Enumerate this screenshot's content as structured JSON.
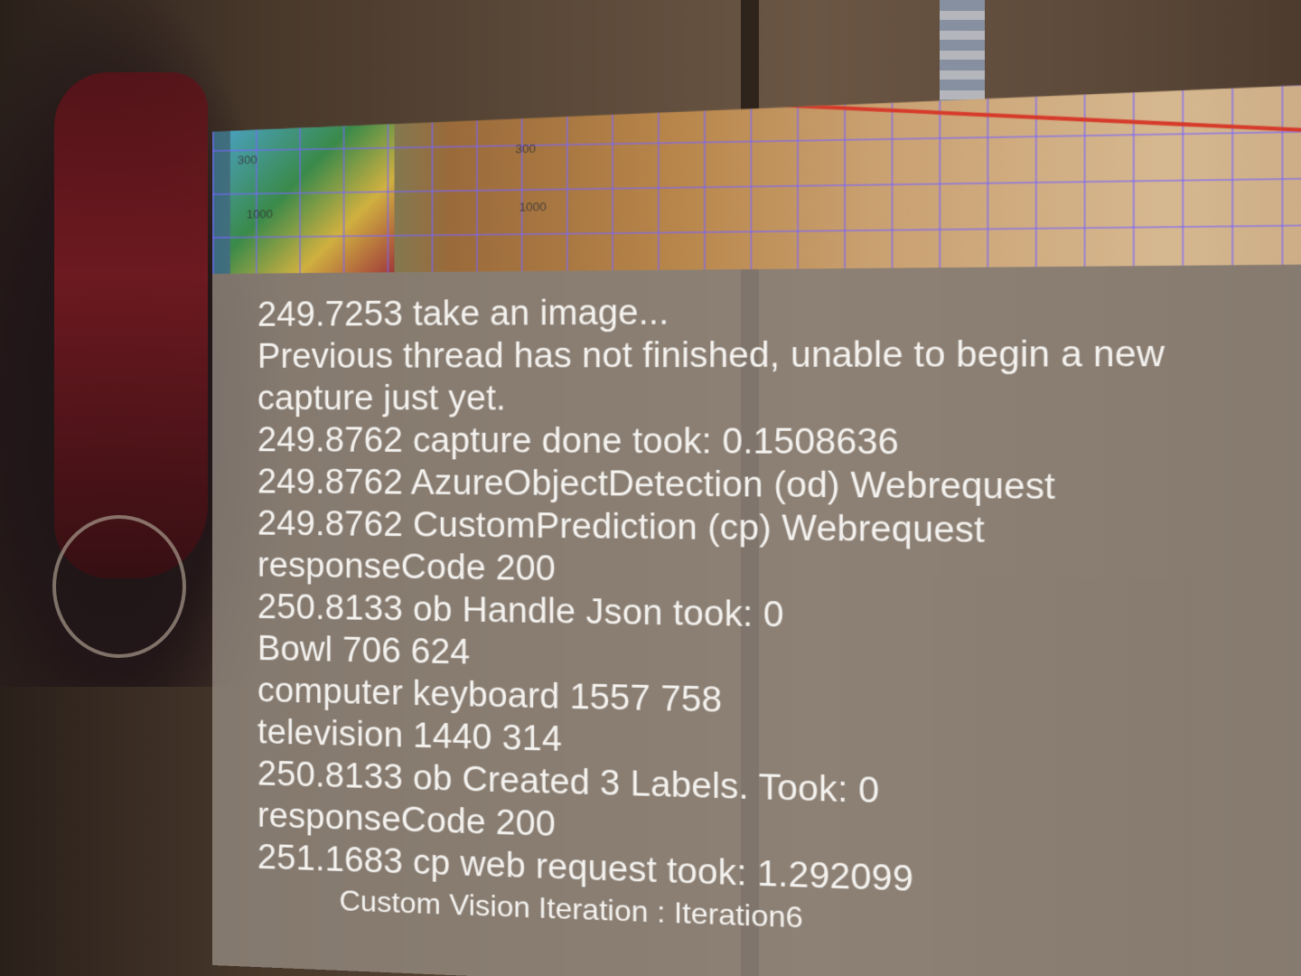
{
  "preview": {
    "scale_labels": [
      "300",
      "300",
      "1000",
      "1000"
    ]
  },
  "log": {
    "lines": [
      "249.7253 take an image...",
      "Previous thread has not finished, unable to begin a new",
      "capture just yet.",
      "249.8762 capture done took: 0.1508636",
      "249.8762 AzureObjectDetection (od) Webrequest",
      "249.8762 CustomPrediction (cp) Webrequest",
      "responseCode 200",
      "250.8133 ob Handle Json took: 0",
      "Bowl 706 624",
      "computer keyboard 1557 758",
      "television 1440 314",
      "250.8133 ob Created 3 Labels. Took: 0",
      "responseCode 200",
      "251.1683 cp web request took: 1.292099"
    ]
  },
  "footer": {
    "iteration": "Custom Vision Iteration : Iteration6"
  }
}
